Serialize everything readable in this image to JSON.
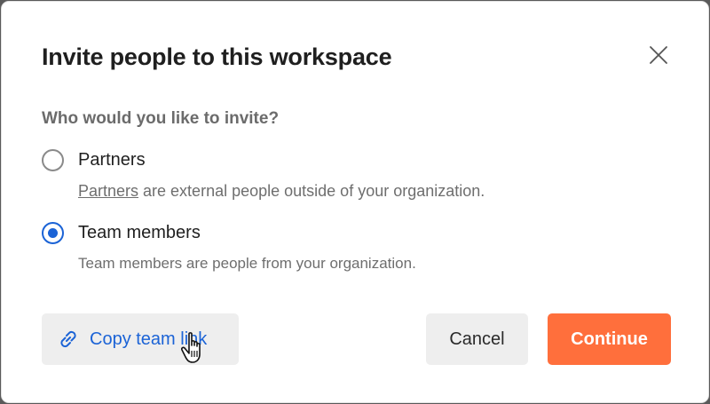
{
  "dialog": {
    "title": "Invite people to this workspace",
    "question": "Who would you like to invite?",
    "options": [
      {
        "label": "Partners",
        "link_text": "Partners",
        "desc_rest": " are external people outside of your organization.",
        "selected": false
      },
      {
        "label": "Team members",
        "desc": "Team members are people from your organization.",
        "selected": true
      }
    ],
    "buttons": {
      "copy_link": "Copy team link",
      "cancel": "Cancel",
      "continue": "Continue"
    }
  },
  "icons": {
    "close": "close-icon",
    "link": "link-icon",
    "cursor": "hand-pointer-icon"
  },
  "colors": {
    "accent": "#1b63d6",
    "primary_button": "#ff6f3c",
    "secondary_button": "#eeeeee"
  }
}
